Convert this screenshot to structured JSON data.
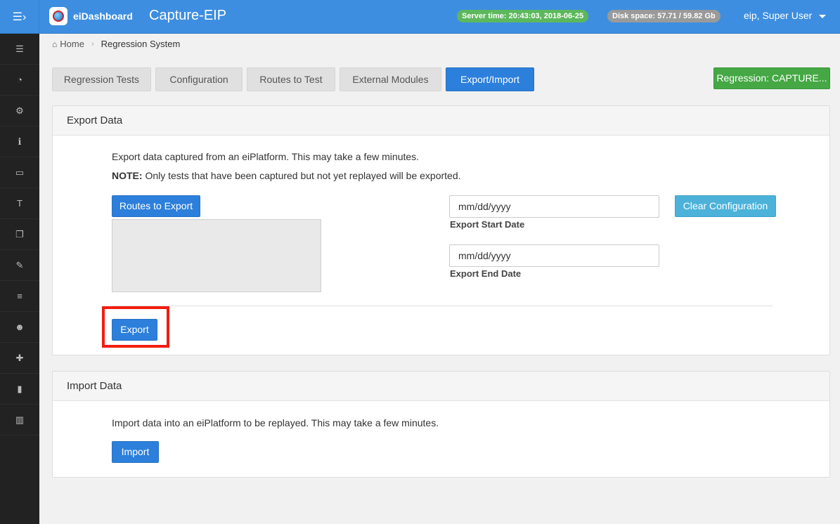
{
  "header": {
    "brand": "eiDashboard",
    "app_title": "Capture-EIP",
    "server_time": "Server time: 20:43:03, 2018-06-25",
    "disk_space": "Disk space: 57.71 / 59.82 Gb",
    "user": "eip, Super User"
  },
  "sidebar": {
    "items": [
      {
        "icon": "list-icon",
        "glyph": "☰"
      },
      {
        "icon": "dashboard-icon",
        "glyph": "◔"
      },
      {
        "icon": "cogs-icon",
        "glyph": "⚙"
      },
      {
        "icon": "info-icon",
        "glyph": "ℹ"
      },
      {
        "icon": "desktop-icon",
        "glyph": "▭"
      },
      {
        "icon": "text-icon",
        "glyph": "T"
      },
      {
        "icon": "copy-icon",
        "glyph": "❐"
      },
      {
        "icon": "edit-icon",
        "glyph": "✎"
      },
      {
        "icon": "list-ul-icon",
        "glyph": "≡"
      },
      {
        "icon": "users-icon",
        "glyph": "☻"
      },
      {
        "icon": "puzzle-icon",
        "glyph": "✚"
      },
      {
        "icon": "file-icon",
        "glyph": "▮"
      },
      {
        "icon": "bar-chart-icon",
        "glyph": "▥"
      }
    ]
  },
  "breadcrumb": {
    "home": "Home",
    "current": "Regression System"
  },
  "tabs": [
    {
      "label": "Regression Tests"
    },
    {
      "label": "Configuration"
    },
    {
      "label": "Routes to Test"
    },
    {
      "label": "External Modules"
    },
    {
      "label": "Export/Import"
    }
  ],
  "regression_button": "Regression: CAPTURE...",
  "export_panel": {
    "title": "Export Data",
    "description": "Export data captured from an eiPlatform. This may take a few minutes.",
    "note_label": "NOTE:",
    "note_text": " Only tests that have been captured but not yet replayed will be exported.",
    "routes_button": "Routes to Export",
    "start_date_placeholder": "mm/dd/yyyy",
    "start_date_label": "Export Start Date",
    "end_date_placeholder": "mm/dd/yyyy",
    "end_date_label": "Export End Date",
    "clear_button": "Clear Configuration",
    "export_button": "Export"
  },
  "import_panel": {
    "title": "Import Data",
    "description": "Import data into an eiPlatform to be replayed. This may take a few minutes.",
    "import_button": "Import"
  },
  "colors": {
    "topbar": "#3d8ee0",
    "primary": "#2c7fdb",
    "success": "#45a845",
    "info": "#4cb2d9",
    "highlight": "#f21d10",
    "sidebar": "#222222"
  }
}
